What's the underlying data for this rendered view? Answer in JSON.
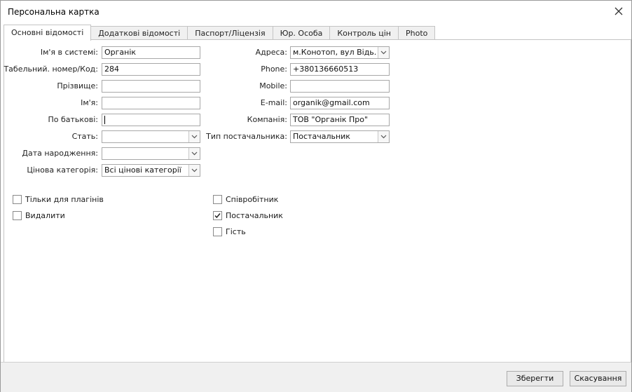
{
  "window": {
    "title": "Персональна картка",
    "close_glyph": "✕"
  },
  "tabs": [
    {
      "label": "Основні відомості"
    },
    {
      "label": "Додаткові відомості"
    },
    {
      "label": "Паспорт/Ліцензія"
    },
    {
      "label": "Юр. Особа"
    },
    {
      "label": "Контроль цін"
    },
    {
      "label": "Photo"
    }
  ],
  "left_form": {
    "system_name": {
      "label": "Ім'я в системі:",
      "value": "Органік"
    },
    "tab_number": {
      "label": "Табельний. номер/Код:",
      "value": "284"
    },
    "surname": {
      "label": "Прізвище:",
      "value": ""
    },
    "first_name": {
      "label": "Ім'я:",
      "value": ""
    },
    "patronymic": {
      "label": "По батькові:",
      "value": ""
    },
    "gender": {
      "label": "Стать:",
      "value": ""
    },
    "birth_date": {
      "label": "Дата народження:",
      "value": ""
    },
    "price_category": {
      "label": "Цінова категорія:",
      "value": "Всі цінові категорії"
    }
  },
  "right_form": {
    "address": {
      "label": "Адреса:",
      "value": "м.Конотоп, вул Відь..."
    },
    "phone": {
      "label": "Phone:",
      "value": "+380136660513"
    },
    "mobile": {
      "label": "Mobile:",
      "value": ""
    },
    "email": {
      "label": "E-mail:",
      "value": "organik@gmail.com"
    },
    "company": {
      "label": "Компанія:",
      "value": "ТОВ \"Органік Про\""
    },
    "supplier_type": {
      "label": "Тип постачальника:",
      "value": "Постачальник"
    }
  },
  "checkboxes": {
    "plugins_only": {
      "label": "Тільки для плагінів",
      "checked": false
    },
    "delete": {
      "label": "Видалити",
      "checked": false
    },
    "employee": {
      "label": "Співробітник",
      "checked": false
    },
    "supplier": {
      "label": "Постачальник",
      "checked": true
    },
    "guest": {
      "label": "Гість",
      "checked": false
    }
  },
  "buttons": {
    "save": "Зберегти",
    "cancel": "Скасування"
  },
  "icons": {
    "close": "close-icon",
    "dropdown": "chevron-down-icon",
    "check": "checkmark-icon"
  }
}
